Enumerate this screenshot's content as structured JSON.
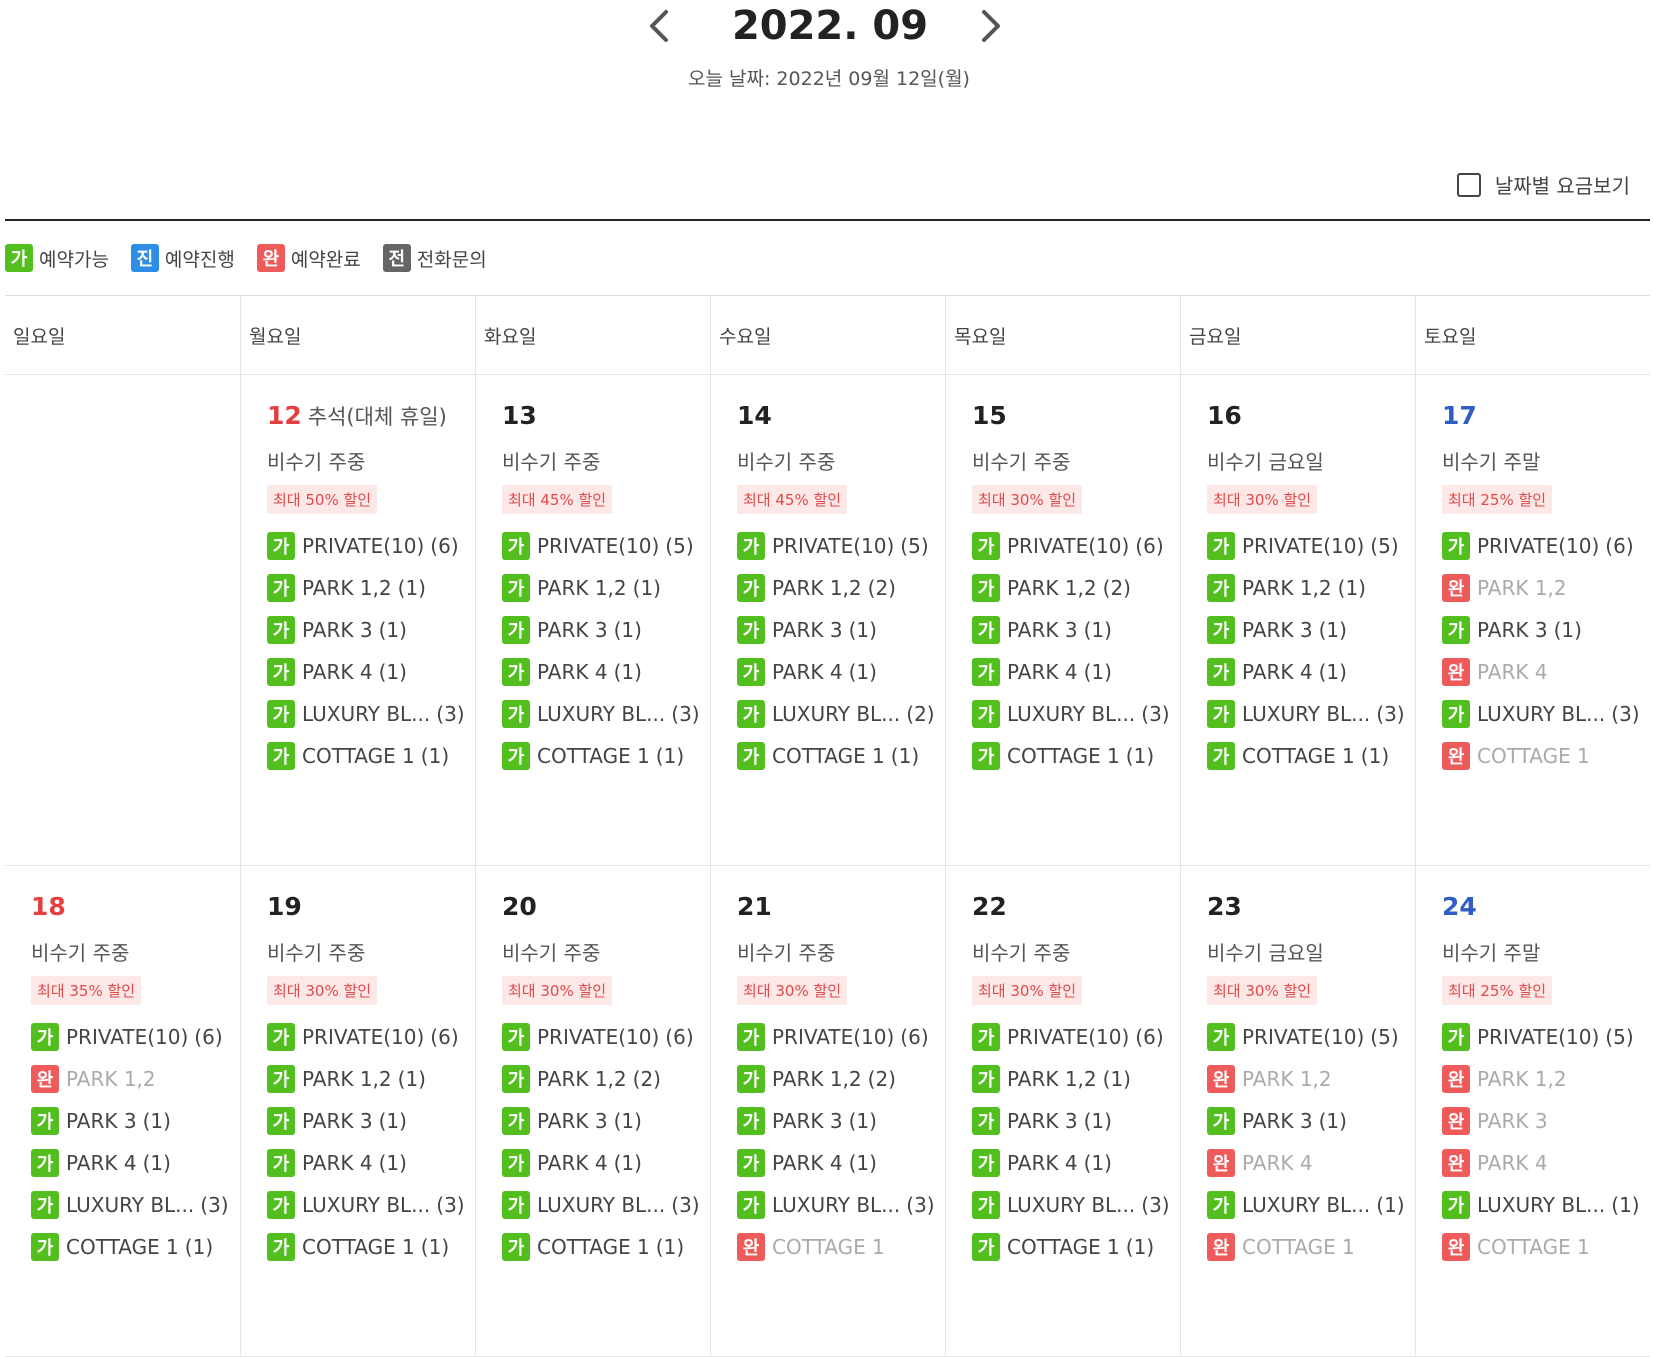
{
  "header": {
    "month": "2022. 09",
    "today": "오늘 날짜: 2022년 09월 12일(월)"
  },
  "price_toggle": {
    "label": "날짜별 요금보기",
    "checked": false
  },
  "legend": [
    {
      "badge": "가",
      "label": "예약가능",
      "status": "avail"
    },
    {
      "badge": "진",
      "label": "예약진행",
      "status": "prog"
    },
    {
      "badge": "완",
      "label": "예약완료",
      "status": "done"
    },
    {
      "badge": "전",
      "label": "전화문의",
      "status": "call"
    }
  ],
  "colors": {
    "avail": "#52bf1e",
    "prog": "#2e8de6",
    "done": "#ef5b5b",
    "call": "#666666",
    "sunday": "#e53e3e",
    "saturday": "#2f5cc7"
  },
  "weekdays": [
    "일요일",
    "월요일",
    "화요일",
    "수요일",
    "목요일",
    "금요일",
    "토요일"
  ],
  "weeks": [
    [
      null,
      {
        "day": "12",
        "holiday": "추석(대체 휴일)",
        "color": "red",
        "season": "비수기 주중",
        "discount": "최대 50% 할인",
        "rooms": [
          {
            "s": "가",
            "name": "PRIVATE(10)",
            "count": "(6)"
          },
          {
            "s": "가",
            "name": "PARK 1,2",
            "count": "(1)"
          },
          {
            "s": "가",
            "name": "PARK 3",
            "count": "(1)"
          },
          {
            "s": "가",
            "name": "PARK 4",
            "count": "(1)"
          },
          {
            "s": "가",
            "name": "LUXURY BL...",
            "count": "(3)"
          },
          {
            "s": "가",
            "name": "COTTAGE 1",
            "count": "(1)"
          }
        ]
      },
      {
        "day": "13",
        "season": "비수기 주중",
        "discount": "최대 45% 할인",
        "rooms": [
          {
            "s": "가",
            "name": "PRIVATE(10)",
            "count": "(5)"
          },
          {
            "s": "가",
            "name": "PARK 1,2",
            "count": "(1)"
          },
          {
            "s": "가",
            "name": "PARK 3",
            "count": "(1)"
          },
          {
            "s": "가",
            "name": "PARK 4",
            "count": "(1)"
          },
          {
            "s": "가",
            "name": "LUXURY BL...",
            "count": "(3)"
          },
          {
            "s": "가",
            "name": "COTTAGE 1",
            "count": "(1)"
          }
        ]
      },
      {
        "day": "14",
        "season": "비수기 주중",
        "discount": "최대 45% 할인",
        "rooms": [
          {
            "s": "가",
            "name": "PRIVATE(10)",
            "count": "(5)"
          },
          {
            "s": "가",
            "name": "PARK 1,2",
            "count": "(2)"
          },
          {
            "s": "가",
            "name": "PARK 3",
            "count": "(1)"
          },
          {
            "s": "가",
            "name": "PARK 4",
            "count": "(1)"
          },
          {
            "s": "가",
            "name": "LUXURY BL...",
            "count": "(2)"
          },
          {
            "s": "가",
            "name": "COTTAGE 1",
            "count": "(1)"
          }
        ]
      },
      {
        "day": "15",
        "season": "비수기 주중",
        "discount": "최대 30% 할인",
        "rooms": [
          {
            "s": "가",
            "name": "PRIVATE(10)",
            "count": "(6)"
          },
          {
            "s": "가",
            "name": "PARK 1,2",
            "count": "(2)"
          },
          {
            "s": "가",
            "name": "PARK 3",
            "count": "(1)"
          },
          {
            "s": "가",
            "name": "PARK 4",
            "count": "(1)"
          },
          {
            "s": "가",
            "name": "LUXURY BL...",
            "count": "(3)"
          },
          {
            "s": "가",
            "name": "COTTAGE 1",
            "count": "(1)"
          }
        ]
      },
      {
        "day": "16",
        "season": "비수기 금요일",
        "discount": "최대 30% 할인",
        "rooms": [
          {
            "s": "가",
            "name": "PRIVATE(10)",
            "count": "(5)"
          },
          {
            "s": "가",
            "name": "PARK 1,2",
            "count": "(1)"
          },
          {
            "s": "가",
            "name": "PARK 3",
            "count": "(1)"
          },
          {
            "s": "가",
            "name": "PARK 4",
            "count": "(1)"
          },
          {
            "s": "가",
            "name": "LUXURY BL...",
            "count": "(3)"
          },
          {
            "s": "가",
            "name": "COTTAGE 1",
            "count": "(1)"
          }
        ]
      },
      {
        "day": "17",
        "color": "blue",
        "season": "비수기 주말",
        "discount": "최대 25% 할인",
        "rooms": [
          {
            "s": "가",
            "name": "PRIVATE(10)",
            "count": "(6)"
          },
          {
            "s": "완",
            "name": "PARK 1,2",
            "count": ""
          },
          {
            "s": "가",
            "name": "PARK 3",
            "count": "(1)"
          },
          {
            "s": "완",
            "name": "PARK 4",
            "count": ""
          },
          {
            "s": "가",
            "name": "LUXURY BL...",
            "count": "(3)"
          },
          {
            "s": "완",
            "name": "COTTAGE 1",
            "count": ""
          }
        ]
      }
    ],
    [
      {
        "day": "18",
        "color": "red",
        "season": "비수기 주중",
        "discount": "최대 35% 할인",
        "rooms": [
          {
            "s": "가",
            "name": "PRIVATE(10)",
            "count": "(6)"
          },
          {
            "s": "완",
            "name": "PARK 1,2",
            "count": ""
          },
          {
            "s": "가",
            "name": "PARK 3",
            "count": "(1)"
          },
          {
            "s": "가",
            "name": "PARK 4",
            "count": "(1)"
          },
          {
            "s": "가",
            "name": "LUXURY BL...",
            "count": "(3)"
          },
          {
            "s": "가",
            "name": "COTTAGE 1",
            "count": "(1)"
          }
        ]
      },
      {
        "day": "19",
        "season": "비수기 주중",
        "discount": "최대 30% 할인",
        "rooms": [
          {
            "s": "가",
            "name": "PRIVATE(10)",
            "count": "(6)"
          },
          {
            "s": "가",
            "name": "PARK 1,2",
            "count": "(1)"
          },
          {
            "s": "가",
            "name": "PARK 3",
            "count": "(1)"
          },
          {
            "s": "가",
            "name": "PARK 4",
            "count": "(1)"
          },
          {
            "s": "가",
            "name": "LUXURY BL...",
            "count": "(3)"
          },
          {
            "s": "가",
            "name": "COTTAGE 1",
            "count": "(1)"
          }
        ]
      },
      {
        "day": "20",
        "season": "비수기 주중",
        "discount": "최대 30% 할인",
        "rooms": [
          {
            "s": "가",
            "name": "PRIVATE(10)",
            "count": "(6)"
          },
          {
            "s": "가",
            "name": "PARK 1,2",
            "count": "(2)"
          },
          {
            "s": "가",
            "name": "PARK 3",
            "count": "(1)"
          },
          {
            "s": "가",
            "name": "PARK 4",
            "count": "(1)"
          },
          {
            "s": "가",
            "name": "LUXURY BL...",
            "count": "(3)"
          },
          {
            "s": "가",
            "name": "COTTAGE 1",
            "count": "(1)"
          }
        ]
      },
      {
        "day": "21",
        "season": "비수기 주중",
        "discount": "최대 30% 할인",
        "rooms": [
          {
            "s": "가",
            "name": "PRIVATE(10)",
            "count": "(6)"
          },
          {
            "s": "가",
            "name": "PARK 1,2",
            "count": "(2)"
          },
          {
            "s": "가",
            "name": "PARK 3",
            "count": "(1)"
          },
          {
            "s": "가",
            "name": "PARK 4",
            "count": "(1)"
          },
          {
            "s": "가",
            "name": "LUXURY BL...",
            "count": "(3)"
          },
          {
            "s": "완",
            "name": "COTTAGE 1",
            "count": ""
          }
        ]
      },
      {
        "day": "22",
        "season": "비수기 주중",
        "discount": "최대 30% 할인",
        "rooms": [
          {
            "s": "가",
            "name": "PRIVATE(10)",
            "count": "(6)"
          },
          {
            "s": "가",
            "name": "PARK 1,2",
            "count": "(1)"
          },
          {
            "s": "가",
            "name": "PARK 3",
            "count": "(1)"
          },
          {
            "s": "가",
            "name": "PARK 4",
            "count": "(1)"
          },
          {
            "s": "가",
            "name": "LUXURY BL...",
            "count": "(3)"
          },
          {
            "s": "가",
            "name": "COTTAGE 1",
            "count": "(1)"
          }
        ]
      },
      {
        "day": "23",
        "season": "비수기 금요일",
        "discount": "최대 30% 할인",
        "rooms": [
          {
            "s": "가",
            "name": "PRIVATE(10)",
            "count": "(5)"
          },
          {
            "s": "완",
            "name": "PARK 1,2",
            "count": ""
          },
          {
            "s": "가",
            "name": "PARK 3",
            "count": "(1)"
          },
          {
            "s": "완",
            "name": "PARK 4",
            "count": ""
          },
          {
            "s": "가",
            "name": "LUXURY BL...",
            "count": "(1)"
          },
          {
            "s": "완",
            "name": "COTTAGE 1",
            "count": ""
          }
        ]
      },
      {
        "day": "24",
        "color": "blue",
        "season": "비수기 주말",
        "discount": "최대 25% 할인",
        "rooms": [
          {
            "s": "가",
            "name": "PRIVATE(10)",
            "count": "(5)"
          },
          {
            "s": "완",
            "name": "PARK 1,2",
            "count": ""
          },
          {
            "s": "완",
            "name": "PARK 3",
            "count": ""
          },
          {
            "s": "완",
            "name": "PARK 4",
            "count": ""
          },
          {
            "s": "가",
            "name": "LUXURY BL...",
            "count": "(1)"
          },
          {
            "s": "완",
            "name": "COTTAGE 1",
            "count": ""
          }
        ]
      }
    ]
  ]
}
